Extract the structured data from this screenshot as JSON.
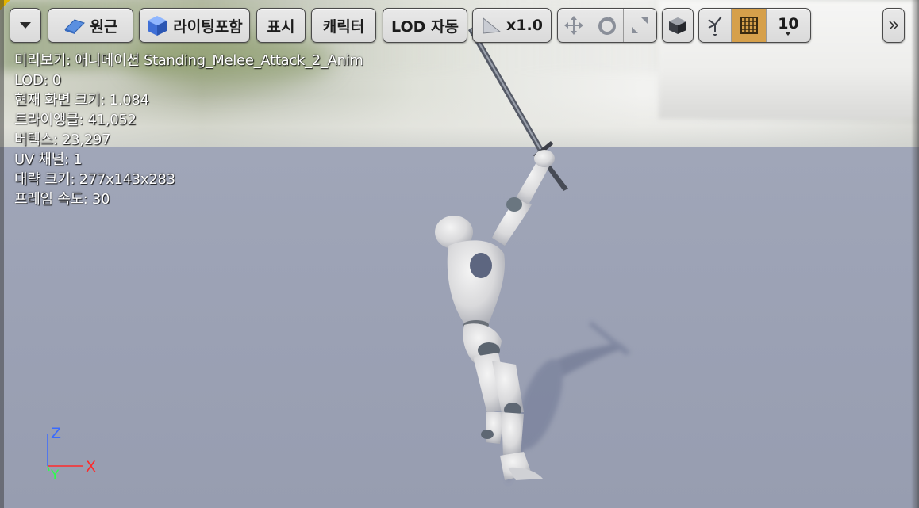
{
  "toolbar": {
    "menu_icon": "chevron-down-icon",
    "perspective_label": "원근",
    "perspective_icon": "perspective-icon",
    "lighting_label": "라이팅포함",
    "lighting_icon": "lit-cube-icon",
    "show_label": "표시",
    "character_label": "캐릭터",
    "lod_label": "LOD 자동",
    "playback_speed_label": "x1.0",
    "playback_icon": "play-icon",
    "transform_icons": [
      "move-icon",
      "rotate-icon",
      "scale-icon"
    ],
    "camera_icon": "camera-cube-icon",
    "snap_icon": "surface-snap-icon",
    "grid_icon": "grid-icon",
    "grid_size_value": "10",
    "overflow_icon": "double-chevron-right-icon"
  },
  "stats": {
    "preview": "미리보기: 애니메이션 Standing_Melee_Attack_2_Anim",
    "lod": "LOD: 0",
    "screen_size": "현재 화면 크기: 1.084",
    "triangles": "트라이앵글: 41,052",
    "vertices": "버텍스: 23,297",
    "uv_channels": "UV 채널: 1",
    "approx_size": "대략 크기: 277x143x283",
    "framerate": "프레임 속도: 30"
  },
  "axis": {
    "z_label": "Z",
    "x_label": "X",
    "y_label": "Y",
    "colors": {
      "x": "#ff2a2a",
      "y": "#2cff4a",
      "z": "#3a6bff"
    }
  },
  "colors": {
    "toolbar_bg": "#e2e2e2",
    "active_toggle": "#d6a04b",
    "floor": "#9ca2b5"
  }
}
